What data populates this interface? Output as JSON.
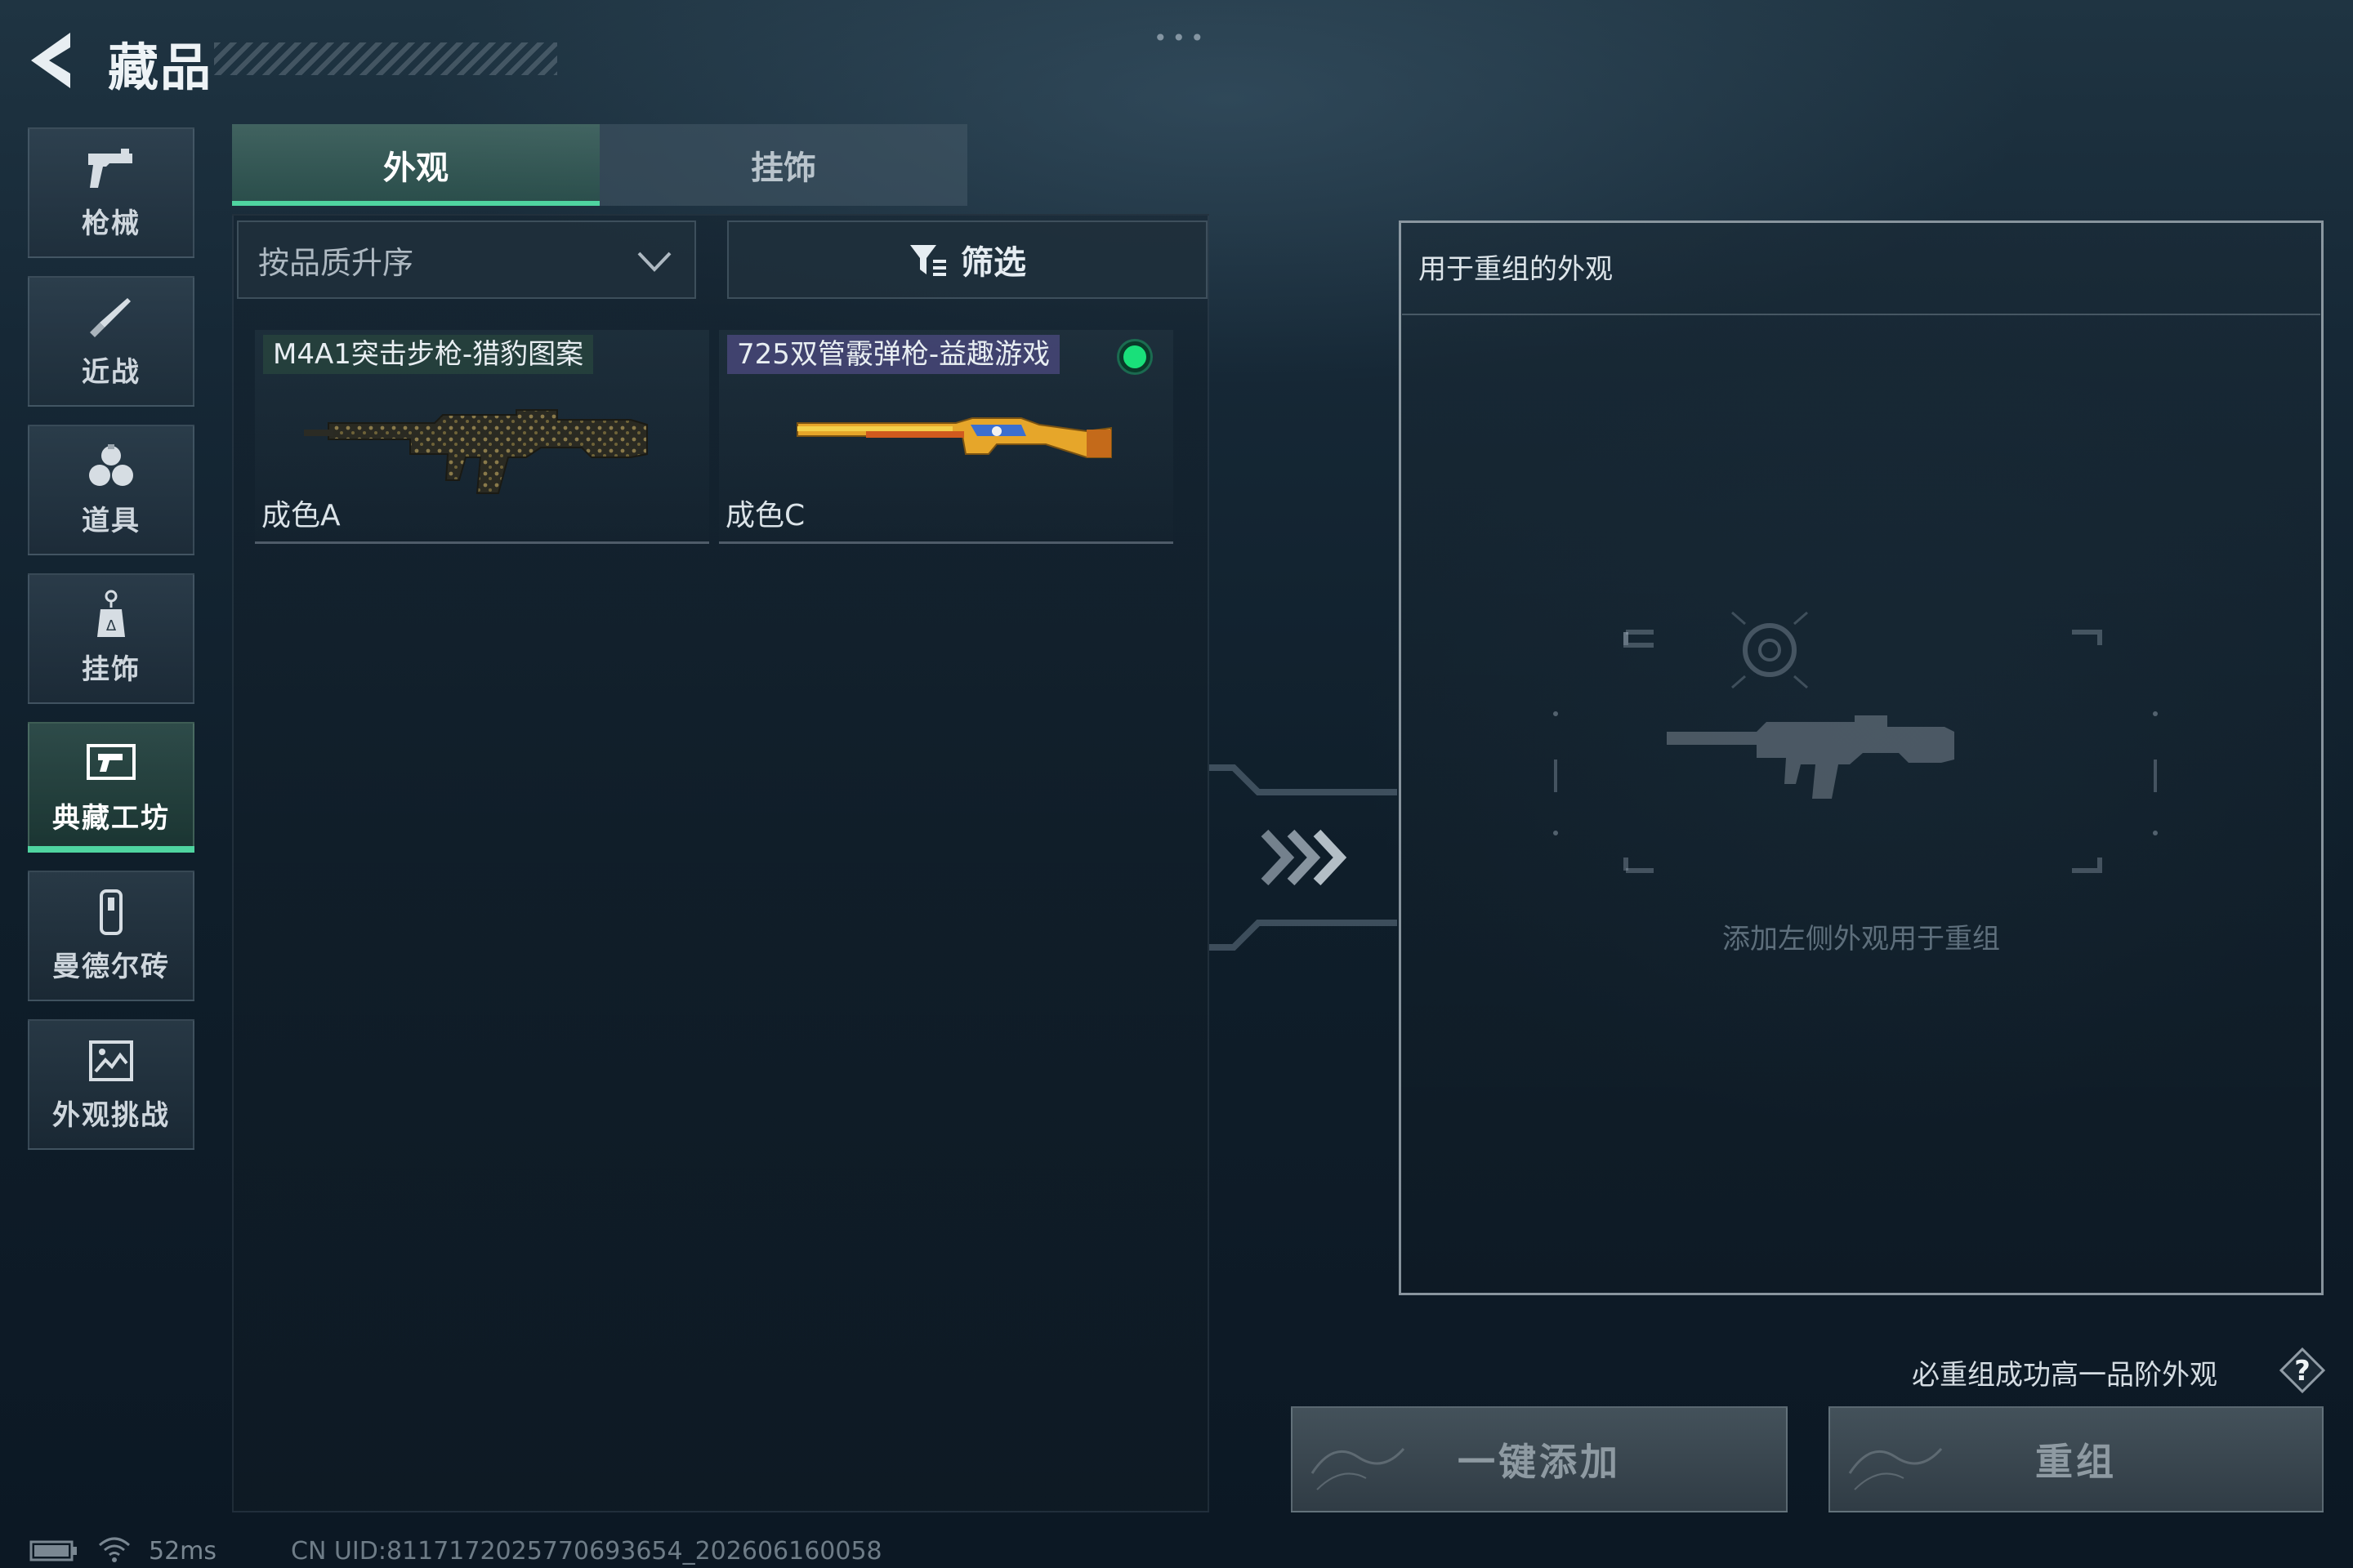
{
  "header": {
    "title": "藏品"
  },
  "sidebar": {
    "items": [
      {
        "label": "枪械",
        "icon": "pistol-icon"
      },
      {
        "label": "近战",
        "icon": "knife-icon"
      },
      {
        "label": "道具",
        "icon": "grenades-icon"
      },
      {
        "label": "挂饰",
        "icon": "charm-icon"
      },
      {
        "label": "典藏工坊",
        "icon": "workshop-icon",
        "active": true
      },
      {
        "label": "曼德尔砖",
        "icon": "mandel-brick-icon"
      },
      {
        "label": "外观挑战",
        "icon": "challenge-icon"
      }
    ]
  },
  "tabs": [
    {
      "label": "外观",
      "active": true
    },
    {
      "label": "挂饰",
      "active": false
    }
  ],
  "toolbar": {
    "sort_label": "按品质升序",
    "filter_label": "筛选"
  },
  "items": [
    {
      "name": "M4A1突击步枪-猎豹图案",
      "grade": "成色A"
    },
    {
      "name": "725双管霰弹枪-益趣游戏",
      "grade": "成色C",
      "selected": true
    }
  ],
  "right_panel": {
    "title": "用于重组的外观",
    "placeholder": "添加左侧外观用于重组"
  },
  "footer": {
    "hint": "必重组成功高一品阶外观",
    "add_all_label": "一键添加",
    "recombine_label": "重组"
  },
  "status": {
    "ping": "52ms",
    "uid": "CN UID:8117172025770693654_202606160058"
  },
  "colors": {
    "accent": "#4fd4a0",
    "selected_dot": "#19e07a"
  }
}
